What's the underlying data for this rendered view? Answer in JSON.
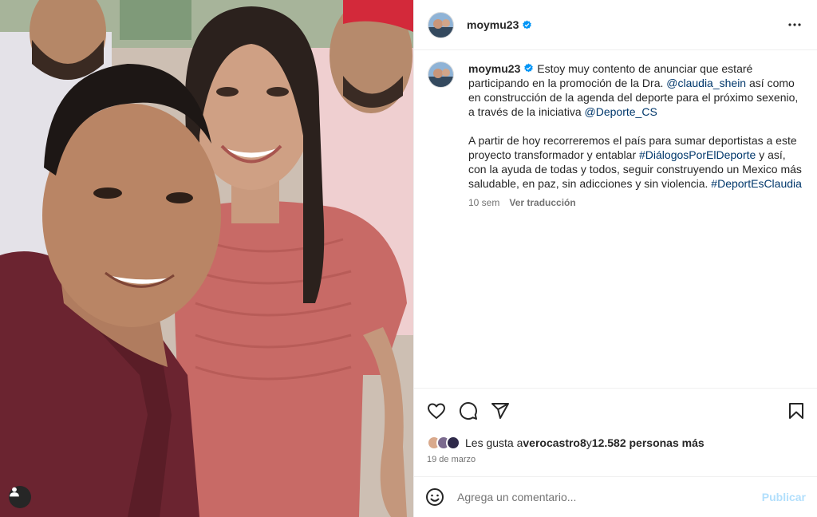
{
  "post": {
    "username": "moymu23",
    "verified": true,
    "caption": {
      "paragraph1_parts": [
        "Estoy muy contento de anunciar que estaré participando en la promoción de la Dra. ",
        "@claudia_shein",
        " así como en construcción de la agenda del deporte para el próximo sexenio, a través de la iniciativa ",
        "@Deporte_CS"
      ],
      "paragraph2_parts": [
        "A partir de hoy recorreremos el país para sumar deportistas a este proyecto transformador y entablar ",
        "#DiálogosPorElDeporte",
        " y así, con la ayuda de todas y todos, seguir construyendo un Mexico más saludable, en paz, sin adicciones y sin violencia. ",
        "#DeportEsClaudia"
      ]
    },
    "time_ago": "10 sem",
    "see_translation": "Ver traducción",
    "likes": {
      "prefix": "Les gusta a ",
      "first_liker": "verocastro8",
      "connector": " y ",
      "others": "12.582 personas más"
    },
    "date": "19 de marzo"
  },
  "comment_box": {
    "placeholder": "Agrega un comentario...",
    "publish_label": "Publicar"
  },
  "icons": {
    "more": "more-horizontal-icon",
    "like": "heart-icon",
    "comment": "comment-bubble-icon",
    "share": "paper-plane-icon",
    "save": "bookmark-icon",
    "emoji": "emoji-icon",
    "tags": "user-tag-icon",
    "verified": "verified-badge-icon"
  },
  "colors": {
    "verified_blue": "#0095f6",
    "link": "#00376b",
    "muted": "#737373",
    "publish_disabled": "#b2dffc"
  }
}
